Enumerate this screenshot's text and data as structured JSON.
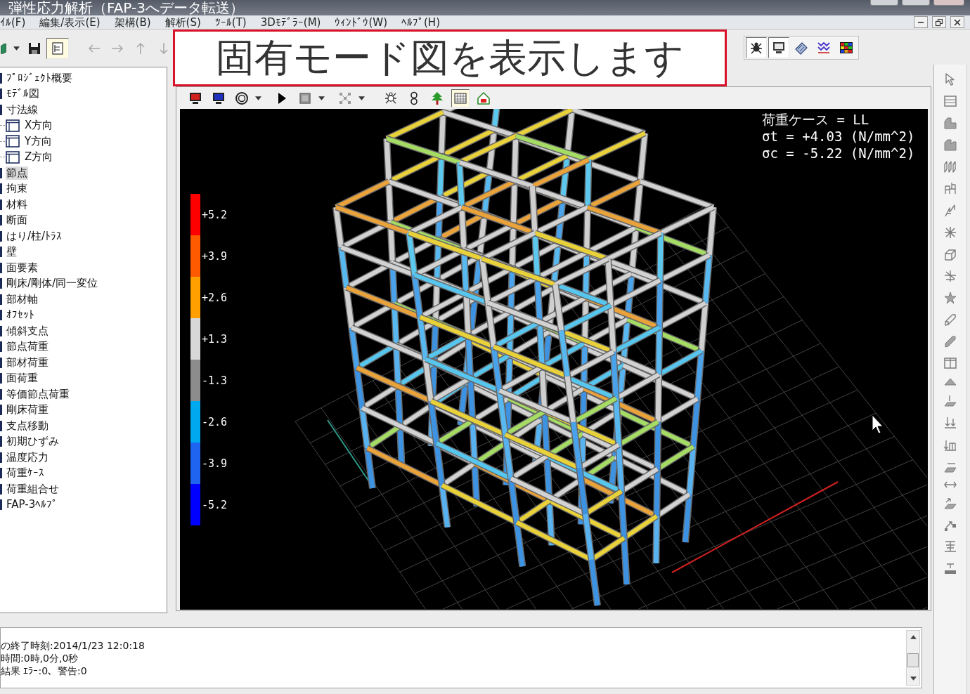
{
  "window": {
    "title": "弾性応力解析（FAP-3へデータ転送）"
  },
  "menu": [
    "ｲﾙ(F)",
    "編集/表示(E)",
    "架構(B)",
    "解析(S)",
    "ﾂｰﾙ(T)",
    "3Dﾓﾃﾞﾗｰ(M)",
    "ｳｨﾝﾄﾞｳ(W)",
    "ﾍﾙﾌﾟ(H)"
  ],
  "left_toolbar": [
    {
      "pressed": false
    },
    {
      "pressed": false
    },
    {
      "pressed": true
    }
  ],
  "nav_buttons": [
    {
      "disabled": true
    },
    {
      "disabled": true
    },
    {
      "disabled": true
    },
    {
      "disabled": true
    }
  ],
  "caption": "固有モード図を表示します",
  "view_toolbar": [
    {
      "pressed": true
    },
    {
      "pressed": true
    },
    {
      "pressed": false
    },
    {
      "pressed": false
    },
    {
      "pressed": false
    }
  ],
  "tree": [
    {
      "label": "ﾌﾟﾛｼﾞｪｸﾄ概要",
      "selected": false
    },
    {
      "label": "ﾓﾃﾞﾙ図",
      "selected": false
    },
    {
      "label": "寸法線",
      "selected": false,
      "children": [
        {
          "label": "X方向",
          "selected": false
        },
        {
          "label": "Y方向",
          "selected": false
        },
        {
          "label": "Z方向",
          "selected": false
        }
      ]
    },
    {
      "label": "節点",
      "selected": true
    },
    {
      "label": "拘束",
      "selected": false
    },
    {
      "label": "材料",
      "selected": false
    },
    {
      "label": "断面",
      "selected": false
    },
    {
      "label": "はり/柱/ﾄﾗｽ",
      "selected": false
    },
    {
      "label": "壁",
      "selected": false
    },
    {
      "label": "面要素",
      "selected": false
    },
    {
      "label": "剛床/剛体/同一変位",
      "selected": false
    },
    {
      "label": "部材軸",
      "selected": false
    },
    {
      "label": "ｵﾌｾｯﾄ",
      "selected": false
    },
    {
      "label": "傾斜支点",
      "selected": false
    },
    {
      "label": "節点荷重",
      "selected": false
    },
    {
      "label": "部材荷重",
      "selected": false
    },
    {
      "label": "面荷重",
      "selected": false
    },
    {
      "label": "等価節点荷重",
      "selected": false
    },
    {
      "label": "剛床荷重",
      "selected": false
    },
    {
      "label": "支点移動",
      "selected": false
    },
    {
      "label": "初期ひずみ",
      "selected": false
    },
    {
      "label": "温度応力",
      "selected": false
    },
    {
      "label": "荷重ｹｰｽ",
      "selected": false
    },
    {
      "label": "荷重組合せ",
      "selected": false
    },
    {
      "label": "FAP-3ﾍﾙﾌﾟ",
      "selected": false
    }
  ],
  "model_view": {
    "toolbar": [
      {
        "pressed": false
      },
      {
        "pressed": false
      },
      {
        "pressed": false
      },
      {
        "pressed": false
      },
      {
        "pressed": false
      },
      {
        "pressed": false
      },
      {
        "pressed": false
      },
      {
        "pressed": false
      },
      {
        "pressed": false
      },
      {
        "pressed": true
      },
      {
        "pressed": false
      }
    ],
    "legend": [
      {
        "label": "+5.2",
        "color": "#ff0000"
      },
      {
        "label": "+3.9",
        "color": "#ff5a00"
      },
      {
        "label": "+2.6",
        "color": "#ffa000"
      },
      {
        "label": "+1.3",
        "color": "#d8d8d8"
      },
      {
        "label": "-1.3",
        "color": "#8c8c8c"
      },
      {
        "label": "-2.6",
        "color": "#00a8f0"
      },
      {
        "label": "-3.9",
        "color": "#1e64f0"
      },
      {
        "label": "-5.2",
        "color": "#0000ff"
      }
    ],
    "info": [
      "荷重ケース = LL",
      "σt = +4.03 (N/mm^2)",
      "σc = -5.22 (N/mm^2)"
    ]
  },
  "log": [
    "の終了時刻:2014/1/23 12:0:18",
    "時間:0時,0分,0秒",
    "結果 ｴﾗｰ:0、警告:0"
  ]
}
